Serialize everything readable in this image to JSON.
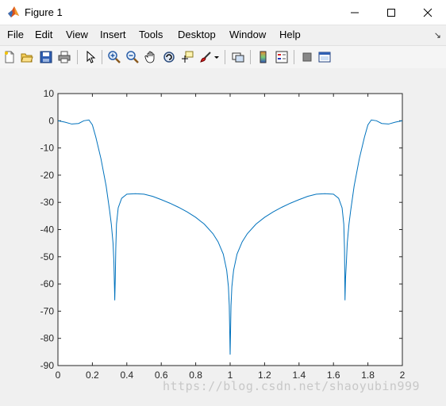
{
  "window": {
    "title": "Figure 1"
  },
  "menu": [
    "File",
    "Edit",
    "View",
    "Insert",
    "Tools",
    "Desktop",
    "Window",
    "Help"
  ],
  "toolbar_icons": [
    "new-figure-icon",
    "open-file-icon",
    "save-icon",
    "print-icon",
    "pointer-icon",
    "zoom-in-icon",
    "zoom-out-icon",
    "pan-icon",
    "rotate-3d-icon",
    "data-cursor-icon",
    "brush-icon",
    "link-plot-icon",
    "insert-colorbar-icon",
    "insert-legend-icon",
    "hide-plot-tools-icon",
    "show-plot-tools-icon"
  ],
  "watermark": "https://blog.csdn.net/shaoyubin999",
  "chart_data": {
    "type": "line",
    "title": "",
    "xlabel": "",
    "ylabel": "",
    "xlim": [
      0,
      2
    ],
    "ylim": [
      -90,
      10
    ],
    "xticks": [
      "0",
      "0.2",
      "0.4",
      "0.6",
      "0.8",
      "1",
      "1.2",
      "1.4",
      "1.6",
      "1.8",
      "2"
    ],
    "yticks": [
      "10",
      "0",
      "-10",
      "-20",
      "-30",
      "-40",
      "-50",
      "-60",
      "-70",
      "-80",
      "-90"
    ],
    "grid": false,
    "line_color": "#0072bd",
    "series": [
      {
        "x": [
          0,
          0.04,
          0.08,
          0.12,
          0.15,
          0.18,
          0.2,
          0.22,
          0.25,
          0.28,
          0.3,
          0.31,
          0.32,
          0.325,
          0.33,
          0.333,
          0.336,
          0.34,
          0.35,
          0.37,
          0.4,
          0.45,
          0.5,
          0.55,
          0.6,
          0.65,
          0.7,
          0.75,
          0.8,
          0.85,
          0.9,
          0.93,
          0.96,
          0.98,
          0.99,
          0.995,
          1.0,
          1.005,
          1.01,
          1.02,
          1.04,
          1.07,
          1.1,
          1.15,
          1.2,
          1.25,
          1.3,
          1.35,
          1.4,
          1.45,
          1.5,
          1.55,
          1.6,
          1.63,
          1.65,
          1.66,
          1.664,
          1.667,
          1.67,
          1.675,
          1.68,
          1.69,
          1.7,
          1.72,
          1.75,
          1.78,
          1.8,
          1.82,
          1.85,
          1.88,
          1.92,
          1.96,
          2.0
        ],
        "y": [
          0,
          -0.5,
          -1.2,
          -1.0,
          0,
          0.3,
          -1.5,
          -6,
          -14,
          -24,
          -33,
          -38,
          -45,
          -52,
          -66,
          -58,
          -47,
          -38,
          -32,
          -28.5,
          -27,
          -26.8,
          -27,
          -27.8,
          -29,
          -30.3,
          -31.8,
          -33.5,
          -35.5,
          -38,
          -41.5,
          -44.5,
          -49,
          -55,
          -61,
          -68,
          -86,
          -68,
          -61,
          -55,
          -49,
          -44.5,
          -41.5,
          -38,
          -35.5,
          -33.5,
          -31.8,
          -30.3,
          -29,
          -27.8,
          -27,
          -26.8,
          -27,
          -28.5,
          -32,
          -38,
          -47,
          -66,
          -58,
          -52,
          -45,
          -38,
          -33,
          -24,
          -14,
          -6,
          -1.5,
          0.3,
          0,
          -1.0,
          -1.2,
          -0.5,
          0
        ]
      }
    ]
  }
}
